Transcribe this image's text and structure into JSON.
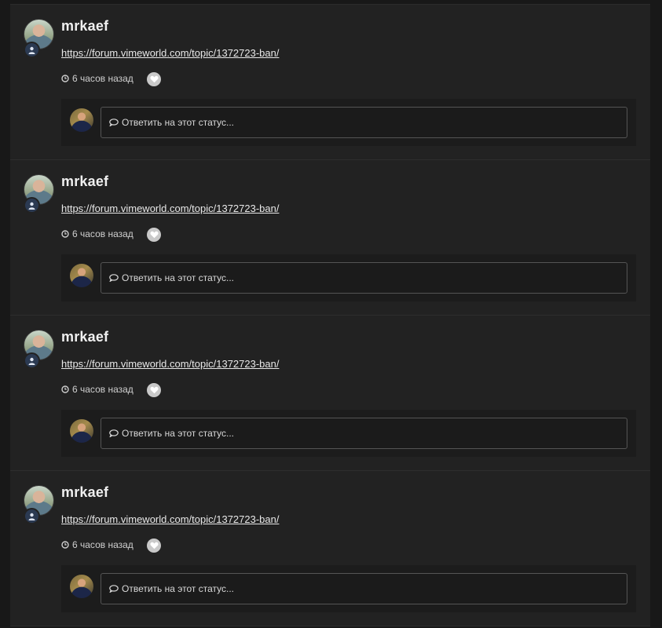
{
  "statuses": [
    {
      "author": "mrkaef",
      "link_text": "https://forum.vimeworld.com/topic/1372723-ban/",
      "time_ago": "6 часов назад",
      "reply_placeholder": "Ответить на этот статус..."
    },
    {
      "author": "mrkaef",
      "link_text": "https://forum.vimeworld.com/topic/1372723-ban/",
      "time_ago": "6 часов назад",
      "reply_placeholder": "Ответить на этот статус..."
    },
    {
      "author": "mrkaef",
      "link_text": "https://forum.vimeworld.com/topic/1372723-ban/",
      "time_ago": "6 часов назад",
      "reply_placeholder": "Ответить на этот статус..."
    },
    {
      "author": "mrkaef",
      "link_text": "https://forum.vimeworld.com/topic/1372723-ban/",
      "time_ago": "6 часов назад",
      "reply_placeholder": "Ответить на этот статус..."
    }
  ],
  "icons": {
    "clock": "clock-icon",
    "like": "heart-icon",
    "badge": "user-icon",
    "reply": "comment-icon"
  },
  "colors": {
    "background": "#181818",
    "panel": "#222222",
    "reply_panel": "#1c1c1c",
    "badge": "#2b3a52"
  }
}
